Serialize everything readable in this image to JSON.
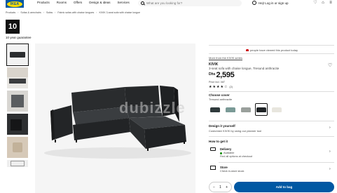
{
  "brand": {
    "logo_text": "IKEA",
    "logo_blue": "#0058a3",
    "logo_yellow": "#ffdb00"
  },
  "nav": [
    "Products",
    "Rooms",
    "Offers",
    "Design & ideas",
    "Services"
  ],
  "search": {
    "placeholder": "What are you looking for?"
  },
  "account": {
    "login_label": "Hej! Log in or sign up"
  },
  "header_icons": [
    "heart-icon",
    "cart-icon",
    "menu-icon"
  ],
  "breadcrumb": [
    "Products",
    "Sofas & armchairs",
    "Sofas",
    "Fabric sofas with chaise longues",
    "KIVIK 3-seat sofa with chaise longue"
  ],
  "guarantee": {
    "years": "10",
    "label": "10 year guarantee"
  },
  "watermark": "dubizzle",
  "product": {
    "viewed_note": "people have viewed this product today",
    "series_link": "More from the KIVIK series",
    "name": "KIVIK",
    "description": "3-seat sofa with chaise longue, Tresund anthracite",
    "currency": "Dhs",
    "price": "2,595",
    "price_note": "Price incl. VAT",
    "rating_count": "(2)",
    "rating_stars": 4
  },
  "cover": {
    "label": "Choose cover",
    "value": "Tresund anthracite",
    "swatches": [
      "#2f3a3c",
      "#7a9a96",
      "#9aa09c",
      "#1e2224",
      "#e8e6de"
    ],
    "selected_index": 3
  },
  "design": {
    "title": "Design it yourself",
    "subtitle": "Customize KIVIK by using our planner tool"
  },
  "how_to_get": {
    "title": "How to get it",
    "delivery_label": "Delivery",
    "available": "Available",
    "find_options": "Find all options at checkout",
    "store_label": "Store",
    "store_sub": "Check in-store stock"
  },
  "purchase": {
    "quantity": "1",
    "minus": "−",
    "plus": "+",
    "add_label": "Add to bag"
  }
}
